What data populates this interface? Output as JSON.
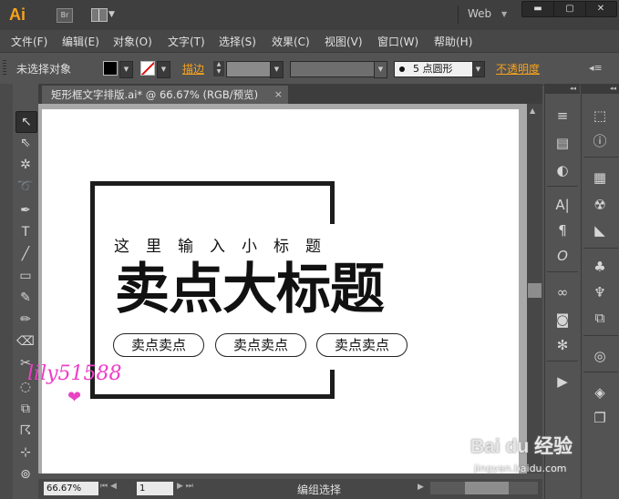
{
  "app": {
    "logo": "Ai",
    "bridge": "Br",
    "workspace": "Web"
  },
  "menu": [
    "文件(F)",
    "编辑(E)",
    "对象(O)",
    "文字(T)",
    "选择(S)",
    "效果(C)",
    "视图(V)",
    "窗口(W)",
    "帮助(H)"
  ],
  "control": {
    "selection": "未选择对象",
    "stroke_label": "描边",
    "brush": "5 点圆形",
    "opacity_label": "不透明度",
    "fill_color": "#000000",
    "accent_color": "#f7a21b"
  },
  "document": {
    "tab": "矩形框文字排版.ai* @ 66.67% (RGB/预览)",
    "close": "×"
  },
  "artwork": {
    "subtitle": "这里输入小标题",
    "title": "卖点大标题",
    "pills": [
      "卖点卖点",
      "卖点卖点",
      "卖点卖点"
    ]
  },
  "status": {
    "zoom": "66.67%",
    "page": "1",
    "text": "编组选择"
  },
  "watermark": {
    "text": "lily51588",
    "baidu": "Bai du 经验",
    "url": "jingyan.baidu.com"
  },
  "icons": {
    "tools": [
      "selection-arrow-icon",
      "direct-selection-icon",
      "magic-wand-icon",
      "lasso-icon",
      "pen-icon",
      "type-icon",
      "line-icon",
      "rectangle-icon",
      "paintbrush-icon",
      "pencil-icon",
      "blob-brush-icon",
      "scissors-icon",
      "rotate-icon",
      "scale-icon",
      "warp-icon",
      "free-transform-icon",
      "symbol-sprayer-icon"
    ]
  }
}
